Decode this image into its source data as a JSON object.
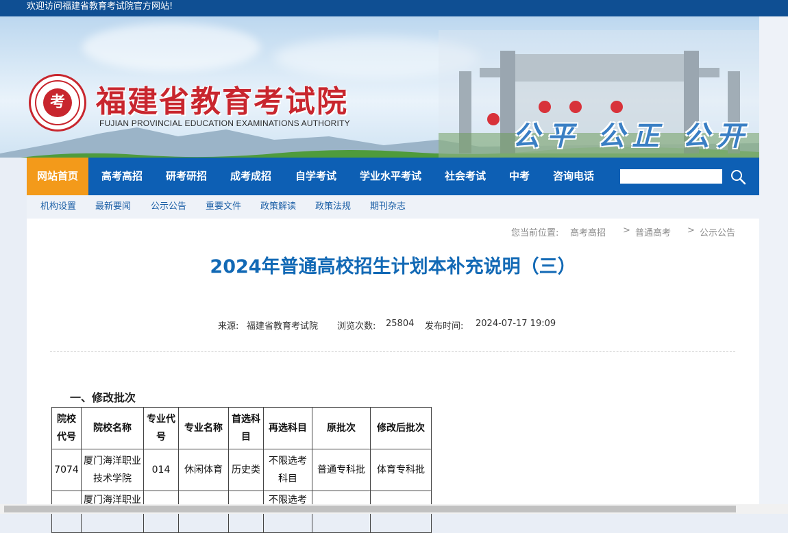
{
  "topbar": {
    "welcome": "欢迎访问福建省教育考试院官方网站!"
  },
  "banner": {
    "logo_cn": "福建省教育考试院",
    "logo_en": "FUJIAN PROVINCIAL EDUCATION EXAMINATIONS AUTHORITY",
    "seal_char": "考",
    "slogan": "公平 公正 公开"
  },
  "nav": {
    "items": [
      "网站首页",
      "高考高招",
      "研考研招",
      "成考成招",
      "自学考试",
      "学业水平考试",
      "社会考试",
      "中考",
      "咨询电话"
    ],
    "search_placeholder": ""
  },
  "subnav": {
    "items": [
      "机构设置",
      "最新要闻",
      "公示公告",
      "重要文件",
      "政策解读",
      "政策法规",
      "期刊杂志"
    ]
  },
  "breadcrumb": {
    "prefix": "您当前位置:",
    "items": [
      "高考高招",
      "普通高考",
      "公示公告"
    ]
  },
  "article": {
    "title": "2024年普通高校招生计划本补充说明（三）",
    "source_label": "来源:",
    "source": "福建省教育考试院",
    "views_label": "浏览次数:",
    "views": "25804",
    "date_label": "发布时间:",
    "date": "2024-07-17 19:09",
    "section1": "一、修改批次"
  },
  "table": {
    "headers": [
      "院校代号",
      "院校名称",
      "专业代号",
      "专业名称",
      "首选科目",
      "再选科目",
      "原批次",
      "修改后批次"
    ],
    "rows": [
      [
        "7074",
        "厦门海洋职业技术学院",
        "014",
        "休闲体育",
        "历史类",
        "不限选考科目",
        "普通专科批",
        "体育专科批"
      ],
      [
        "",
        "厦门海洋职业",
        "",
        "",
        "",
        "不限选考",
        "",
        ""
      ]
    ]
  },
  "colors": {
    "nav_bg": "#0d5fb4",
    "home_bg": "#f39a1a",
    "title": "#1269b5",
    "topbar": "#0f4f93"
  }
}
